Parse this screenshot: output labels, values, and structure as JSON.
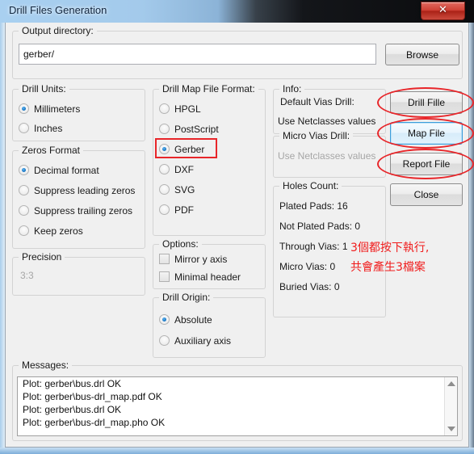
{
  "window": {
    "title": "Drill Files Generation",
    "close_label": "✕"
  },
  "output_directory": {
    "group_label": "Output directory:",
    "value": "gerber/",
    "placeholder": "",
    "browse_label": "Browse"
  },
  "drill_units": {
    "group_label": "Drill Units:",
    "options": [
      {
        "label": "Millimeters",
        "selected": true
      },
      {
        "label": "Inches",
        "selected": false
      }
    ]
  },
  "zeros_format": {
    "group_label": "Zeros Format",
    "options": [
      {
        "label": "Decimal format",
        "selected": true
      },
      {
        "label": "Suppress leading zeros",
        "selected": false
      },
      {
        "label": "Suppress trailing zeros",
        "selected": false
      },
      {
        "label": "Keep zeros",
        "selected": false
      }
    ]
  },
  "precision": {
    "group_label": "Precision",
    "value": "3:3",
    "disabled": true
  },
  "drill_map_format": {
    "group_label": "Drill Map File Format:",
    "options": [
      {
        "label": "HPGL",
        "selected": false
      },
      {
        "label": "PostScript",
        "selected": false
      },
      {
        "label": "Gerber",
        "selected": true
      },
      {
        "label": "DXF",
        "selected": false
      },
      {
        "label": "SVG",
        "selected": false
      },
      {
        "label": "PDF",
        "selected": false
      }
    ]
  },
  "options": {
    "group_label": "Options:",
    "items": [
      {
        "label": "Mirror y axis",
        "checked": false
      },
      {
        "label": "Minimal header",
        "checked": false
      }
    ]
  },
  "drill_origin": {
    "group_label": "Drill Origin:",
    "options": [
      {
        "label": "Absolute",
        "selected": true
      },
      {
        "label": "Auxiliary axis",
        "selected": false
      }
    ]
  },
  "info": {
    "group_label": "Info:",
    "default_vias_drill": {
      "label": "Default Vias Drill:",
      "value": "Use Netclasses values",
      "disabled": false
    },
    "micro_vias_drill": {
      "label": "Micro Vias Drill:",
      "value": "Use Netclasses values",
      "disabled": true
    },
    "holes_count": {
      "label": "Holes Count:",
      "rows": [
        {
          "label": "Plated Pads:",
          "value": "16",
          "text": "Plated Pads: 16"
        },
        {
          "label": "Not Plated Pads:",
          "value": "0",
          "text": "Not Plated Pads: 0"
        },
        {
          "label": "Through Vias:",
          "value": "1",
          "text": "Through Vias: 1"
        },
        {
          "label": "Micro Vias:",
          "value": "0",
          "text": "Micro Vias: 0"
        },
        {
          "label": "Buried Vias:",
          "value": "0",
          "text": "Buried Vias: 0"
        }
      ]
    }
  },
  "action_buttons": {
    "drill_file": "Drill Fille",
    "map_file": "Map File",
    "report_file": "Report File",
    "close": "Close"
  },
  "messages": {
    "group_label": "Messages:",
    "lines": [
      "Plot: gerber\\bus.drl OK",
      "Plot: gerber\\bus-drl_map.pdf OK",
      "Plot: gerber\\bus.drl OK",
      "Plot: gerber\\bus-drl_map.pho OK"
    ]
  },
  "annotations": {
    "color": "#f01c1c",
    "note_line1": "3個都按下執行,",
    "note_line2": "共會產生3檔案"
  }
}
